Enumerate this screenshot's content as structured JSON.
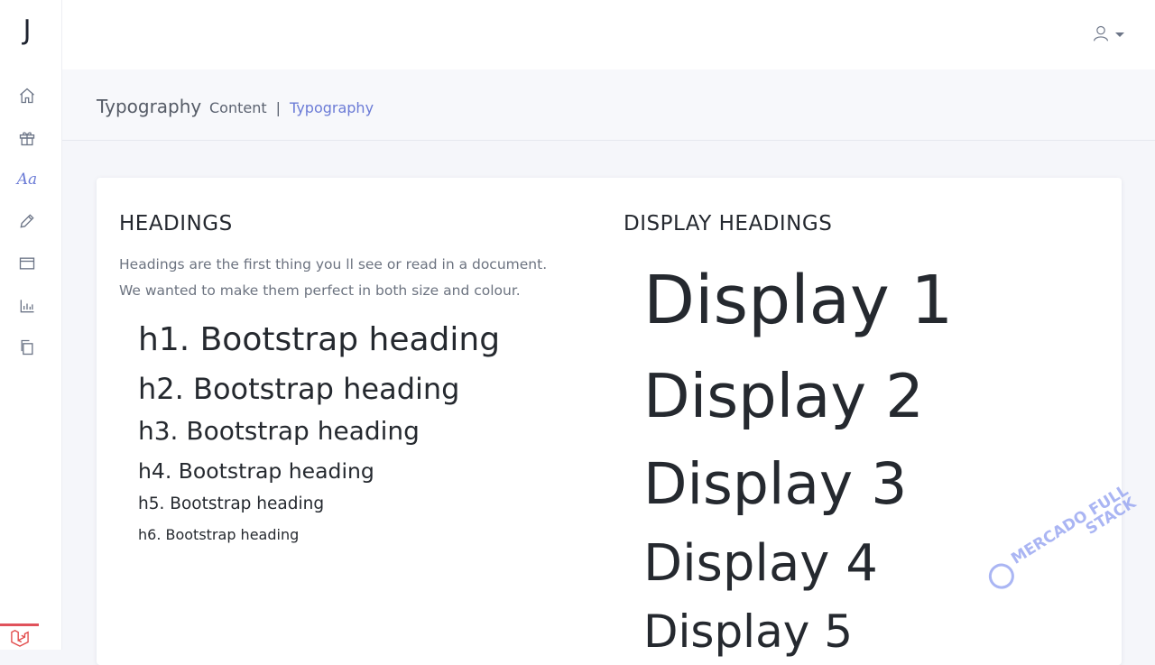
{
  "brand": {
    "letter": "J"
  },
  "sidebar": {
    "items": [
      {
        "name": "home",
        "icon": "home-icon"
      },
      {
        "name": "gift",
        "icon": "gift-icon"
      },
      {
        "name": "typography",
        "icon": "typography-icon",
        "label": "Aa",
        "active": true
      },
      {
        "name": "pencil",
        "icon": "pencil-icon"
      },
      {
        "name": "window",
        "icon": "window-icon"
      },
      {
        "name": "chart",
        "icon": "chart-icon"
      },
      {
        "name": "copy",
        "icon": "copy-icon"
      }
    ],
    "bottom_icon": "laravel-logo-icon"
  },
  "topbar": {
    "user_icon": "user-icon"
  },
  "header": {
    "title": "Typography",
    "breadcrumb": {
      "parent": "Content",
      "separator": "|",
      "current": "Typography"
    }
  },
  "headings": {
    "title": "HEADINGS",
    "lead": "Headings are the first thing you ll see or read in a document. We wanted to make them perfect in both size and colour.",
    "h1": "h1. Bootstrap heading",
    "h2": "h2. Bootstrap heading",
    "h3": "h3. Bootstrap heading",
    "h4": "h4. Bootstrap heading",
    "h5": "h5. Bootstrap heading",
    "h6": "h6. Bootstrap heading"
  },
  "display": {
    "title": "DISPLAY HEADINGS",
    "d1": "Display 1",
    "d2": "Display 2",
    "d3": "Display 3",
    "d4": "Display 4",
    "d5": "Display 5"
  },
  "watermark": {
    "line1": "MERCADO FULL",
    "line2": "STACK"
  },
  "colors": {
    "accent": "#6b7bd6",
    "laravel": "#e24c4c"
  }
}
